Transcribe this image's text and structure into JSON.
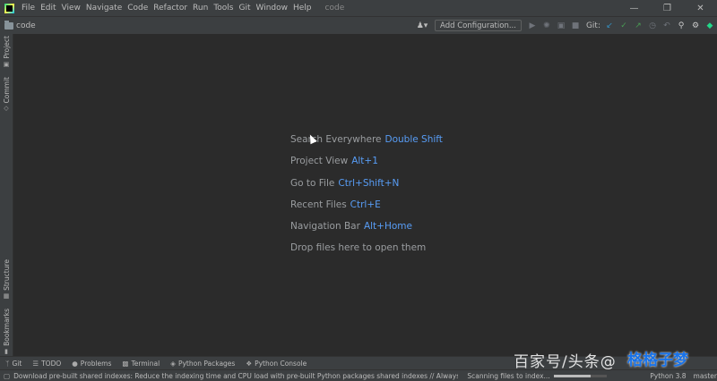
{
  "menubar": {
    "items": [
      "File",
      "Edit",
      "View",
      "Navigate",
      "Code",
      "Refactor",
      "Run",
      "Tools",
      "Git",
      "Window",
      "Help"
    ],
    "title": "code"
  },
  "navbar": {
    "project": "code",
    "add_config_label": "Add Configuration...",
    "git_label": "Git:"
  },
  "left_tabs": {
    "project": "Project",
    "commit": "Commit",
    "structure": "Structure",
    "bookmarks": "Bookmarks"
  },
  "hints": [
    {
      "label": "Search Everywhere",
      "shortcut": "Double Shift"
    },
    {
      "label": "Project View",
      "shortcut": "Alt+1"
    },
    {
      "label": "Go to File",
      "shortcut": "Ctrl+Shift+N"
    },
    {
      "label": "Recent Files",
      "shortcut": "Ctrl+E"
    },
    {
      "label": "Navigation Bar",
      "shortcut": "Alt+Home"
    },
    {
      "label": "Drop files here to open them",
      "shortcut": ""
    }
  ],
  "bottom_tools": {
    "git": "Git",
    "todo": "TODO",
    "problems": "Problems",
    "terminal": "Terminal",
    "python_packages": "Python Packages",
    "python_console": "Python Console"
  },
  "statusbar": {
    "message": "Download pre-built shared indexes: Reduce the indexing time and CPU load with pre-built Python packages shared indexes // Always",
    "indexing": "Scanning files to index...",
    "indexing_progress": 0.7,
    "interpreter": "Python 3.8",
    "branch": "master"
  },
  "watermark": {
    "text": "百家号/头条@",
    "logo": "格",
    "logo_text": "格子梦"
  },
  "colors": {
    "background": "#2b2b2b",
    "chrome": "#3c3f41",
    "shortcut": "#589df6"
  }
}
